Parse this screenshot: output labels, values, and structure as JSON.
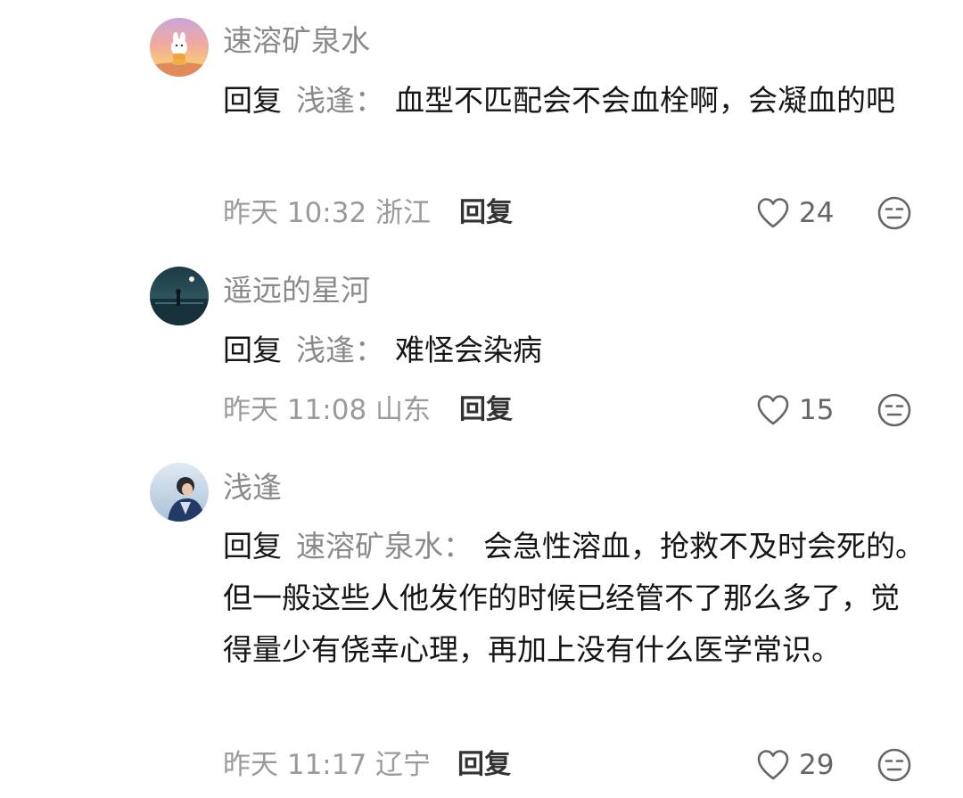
{
  "comments": [
    {
      "username": "速溶矿泉水",
      "reply_prefix": "回复",
      "reply_to": "浅逢",
      "colon": "：",
      "text": "血型不匹配会不会血栓啊，会凝血的吧",
      "meta": "昨天 10:32 浙江",
      "reply_label": "回复",
      "likes": "24",
      "avatar_icon": "sunset-cartoon-avatar",
      "dislike_icon": "meh-face-icon"
    },
    {
      "username": "遥远的星河",
      "reply_prefix": "回复",
      "reply_to": "浅逢",
      "colon": "：",
      "text": "难怪会染病",
      "meta": "昨天 11:08 山东",
      "reply_label": "回复",
      "likes": "15",
      "avatar_icon": "night-sea-avatar",
      "dislike_icon": "meh-face-icon"
    },
    {
      "username": "浅逢",
      "reply_prefix": "回复",
      "reply_to": "速溶矿泉水",
      "colon": "：",
      "text": "会急性溶血，抢救不及时会死的。但一般这些人他发作的时候已经管不了那么多了，觉得量少有侥幸心理，再加上没有什么医学常识。",
      "meta": "昨天 11:17 辽宁",
      "reply_label": "回复",
      "likes": "29",
      "avatar_icon": "person-photo-avatar",
      "dislike_icon": "meh-face-icon"
    }
  ],
  "colors": {
    "text": "#161616",
    "muted": "#8a8a8a",
    "meta": "#9a9a9a"
  }
}
